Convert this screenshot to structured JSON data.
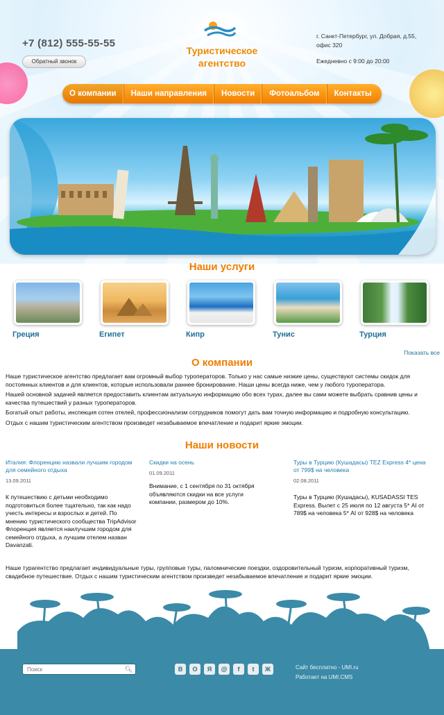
{
  "header": {
    "phone": "+7 (812) 555-55-55",
    "callback_label": "Обратный звонок",
    "brand_line1": "Туристическое",
    "brand_line2": "агентство",
    "address": "г. Санкт-Петербург, ул. Добрая, д.55, офис 320",
    "hours": "Ежедневно с 9:00 до 20:00"
  },
  "nav": [
    "О компании",
    "Наши направления",
    "Новости",
    "Фотоальбом",
    "Контакты"
  ],
  "services": {
    "title": "Наши услуги",
    "items": [
      "Греция",
      "Египет",
      "Кипр",
      "Тунис",
      "Турция"
    ],
    "show_all": "Показать все"
  },
  "about": {
    "title": "О компании",
    "p1": "Наше туристическое агентство предлагает вам огромный выбор туроператоров. Только у нас самые низкие цены, существуют системы скидок для постоянных клиентов и для клиентов, которые использовали раннее бронирование. Наши цены всегда ниже, чем у любого туроператора.",
    "p2": "Нашей основной задачей является предоставить клиентам актуальную информацию обо всех турах, далее вы сами можете выбрать сравнив цены и качества путешествий у разных туроператоров.",
    "p3": "Богатый опыт работы, инспекция сотен отелей, профессионализм сотрудников помогут дать вам точную информацию и подробную консультацию.",
    "p4": "Отдых с нашим туристическим агентством произведет незабываемое впечатление и подарит яркие эмоции."
  },
  "news": {
    "title": "Наши новости",
    "items": [
      {
        "title": "Италия: Флоренцию назвали лучшим городом для семейного отдыха",
        "date": "13.09.2011",
        "body": "К путешествию с детьми необходимо подготовиться более тщательно, так как надо учесть интересы и взрослых и детей. По мнению туристического сообщества TripAdvisor Флоренция является наилучшим городом для семейного отдыха, а лучшим отелем назван Davanzati."
      },
      {
        "title": "Скидки на осень",
        "date": "01.09.2011",
        "body": "Внимание, с 1 сентября по 31 октября объявляются скидки на все услуги компании, размером до 10%."
      },
      {
        "title": "Туры в Турцию (Кушадасы) TEZ Express 4* цена от 799$ на человека",
        "date": "02.08.2011",
        "body": "Туры в Турцию (Кушадасы), KUSADASSI TES Express. Вылет с 25 июля по 12 августа 5* AI от 789$ на человека 5* AI от 928$ на человека"
      }
    ]
  },
  "bottom_text": "Наше турагентство предлагает индивидуальные туры, групповые туры, паломнические поездки, оздоровительный туризм, корпоративный туризм, свадебное путешествие. Отдых с нашим туристическим агентством произведет незабываемое впечатление и подарит яркие эмоции.",
  "footer": {
    "search_placeholder": "Поиск",
    "social": [
      "В",
      "О",
      "Я",
      "@",
      "f",
      "t",
      "Ж"
    ],
    "link1": "Сайт бесплатно - UMI.ru",
    "link2": "Работает на UMI.CMS"
  },
  "colors": {
    "accent": "#f07d00",
    "link": "#1f6f96",
    "footer": "#3a8aa8"
  }
}
